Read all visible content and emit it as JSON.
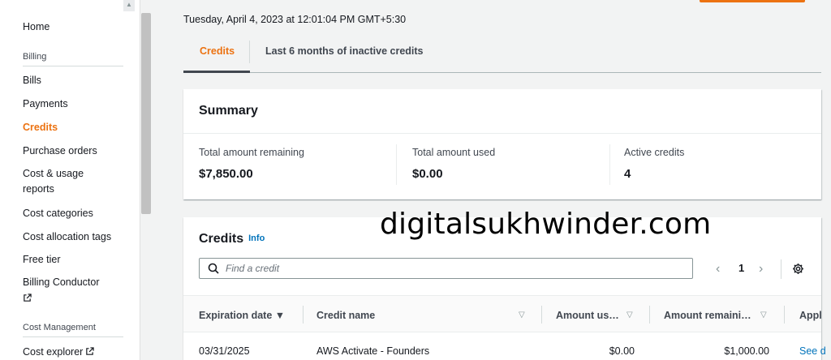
{
  "sidebar": {
    "items": [
      {
        "label": "Home"
      },
      {
        "section": "Billing"
      },
      {
        "label": "Bills"
      },
      {
        "label": "Payments"
      },
      {
        "label": "Credits",
        "active": true
      },
      {
        "label": "Purchase orders"
      },
      {
        "label": "Cost & usage"
      },
      {
        "label": "reports"
      },
      {
        "label": "Cost categories"
      },
      {
        "label": "Cost allocation tags"
      },
      {
        "label": "Free tier"
      },
      {
        "label": "Billing Conductor"
      },
      {
        "section": "Cost Management"
      },
      {
        "label": "Cost explorer"
      }
    ]
  },
  "timestamp": "Tuesday, April 4, 2023 at 12:01:04 PM GMT+5:30",
  "tabs": [
    {
      "label": "Credits",
      "active": true
    },
    {
      "label": "Last 6 months of inactive credits"
    }
  ],
  "summary": {
    "title": "Summary",
    "stats": [
      {
        "label": "Total amount remaining",
        "value": "$7,850.00"
      },
      {
        "label": "Total amount used",
        "value": "$0.00"
      },
      {
        "label": "Active credits",
        "value": "4"
      }
    ]
  },
  "credits_table": {
    "title": "Credits",
    "info_label": "Info",
    "search_placeholder": "Find a credit",
    "page_number": "1",
    "columns": [
      "Expiration date ▼",
      "Credit name",
      "Amount us…",
      "Amount remaini…",
      "Appl"
    ],
    "rows": [
      {
        "expiration": "03/31/2025",
        "name": "AWS Activate - Founders",
        "used": "$0.00",
        "remaining": "$1,000.00",
        "link": "See d"
      }
    ]
  },
  "watermark": "digitalsukhwinder.com",
  "colors": {
    "accent": "#ec7211",
    "link": "#0073bb"
  }
}
